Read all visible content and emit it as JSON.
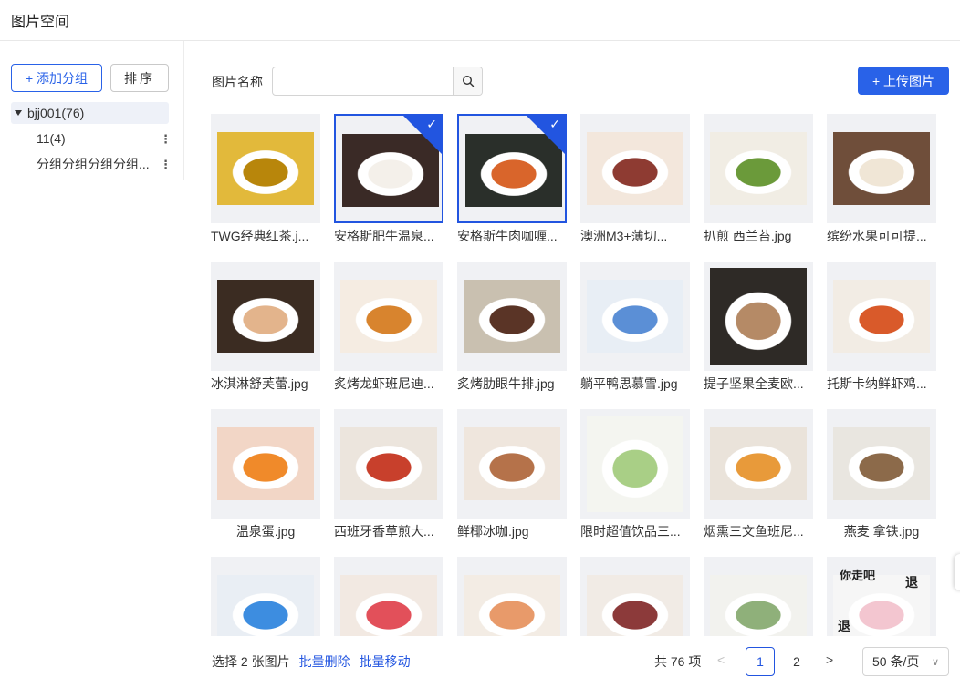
{
  "header": {
    "title": "图片空间"
  },
  "sidebar": {
    "add_group_label": "+ 添加分组",
    "sort_label": "排序",
    "root": {
      "label": "bjj001(76)"
    },
    "children": [
      {
        "label": "11(4)"
      },
      {
        "label": "分组分组分组分组..."
      }
    ]
  },
  "toolbar": {
    "search_label": "图片名称",
    "search_value": "",
    "search_placeholder": "",
    "upload_label": "+ 上传图片"
  },
  "images": [
    {
      "name": "TWG经典红茶.j...",
      "selected": false,
      "color1": "#e2b93b",
      "color2": "#b8860b"
    },
    {
      "name": "安格斯肥牛温泉...",
      "selected": true,
      "color1": "#3a2a26",
      "color2": "#f4f0ea"
    },
    {
      "name": "安格斯牛肉咖喱...",
      "selected": true,
      "color1": "#2a2f2a",
      "color2": "#d9652b"
    },
    {
      "name": "澳洲M3+薄切...",
      "selected": false,
      "color1": "#f3e7dc",
      "color2": "#8e3b32"
    },
    {
      "name": "扒煎 西兰苔.jpg",
      "selected": false,
      "color1": "#f1ede4",
      "color2": "#6b9a3a"
    },
    {
      "name": "缤纷水果可可提...",
      "selected": false,
      "color1": "#6f4e3a",
      "color2": "#f0e6d6"
    },
    {
      "name": "冰淇淋舒芙蕾.jpg",
      "selected": false,
      "color1": "#3b2c22",
      "color2": "#e3b48c"
    },
    {
      "name": "炙烤龙虾班尼迪...",
      "selected": false,
      "color1": "#f5ece2",
      "color2": "#d8842e"
    },
    {
      "name": "炙烤肋眼牛排.jpg",
      "selected": false,
      "color1": "#c9c0b0",
      "color2": "#5a3426"
    },
    {
      "name": "躺平鸭思慕雪.jpg",
      "selected": false,
      "color1": "#e8eef5",
      "color2": "#5b8fd6"
    },
    {
      "name": "提子坚果全麦欧...",
      "selected": false,
      "color1": "#2e2a26",
      "color2": "#b58a66"
    },
    {
      "name": "托斯卡纳鲜虾鸡...",
      "selected": false,
      "color1": "#f2ece4",
      "color2": "#d95a2a"
    },
    {
      "name": "温泉蛋.jpg",
      "selected": false,
      "color1": "#f2d6c6",
      "color2": "#f08a2a"
    },
    {
      "name": "西班牙香草煎大...",
      "selected": false,
      "color1": "#ece5dd",
      "color2": "#c8402c"
    },
    {
      "name": "鲜椰冰咖.jpg",
      "selected": false,
      "color1": "#efe6dd",
      "color2": "#b5724a"
    },
    {
      "name": "限时超值饮品三...",
      "selected": false,
      "color1": "#f4f5f0",
      "color2": "#a9cf86"
    },
    {
      "name": "烟熏三文鱼班尼...",
      "selected": false,
      "color1": "#eae3da",
      "color2": "#e89a3a"
    },
    {
      "name": "燕麦 拿铁.jpg",
      "selected": false,
      "color1": "#e9e6e0",
      "color2": "#8c6a4a"
    },
    {
      "name": "",
      "selected": false,
      "color1": "#e9eef4",
      "color2": "#3d8de0"
    },
    {
      "name": "",
      "selected": false,
      "color1": "#f2e9e2",
      "color2": "#e2505a"
    },
    {
      "name": "",
      "selected": false,
      "color1": "#f3ece4",
      "color2": "#e89a6a"
    },
    {
      "name": "",
      "selected": false,
      "color1": "#f1ebe5",
      "color2": "#8c3a3a"
    },
    {
      "name": "",
      "selected": false,
      "color1": "#f2f2ee",
      "color2": "#8fb07a"
    },
    {
      "name": "",
      "selected": false,
      "color1": "#f6f6f6",
      "color2": "#f3c6d0",
      "sticker_text_1": "你走吧",
      "sticker_text_2": "退",
      "sticker_text_3": "退"
    }
  ],
  "footer": {
    "selected_text": "选择 2 张图片",
    "batch_delete": "批量删除",
    "batch_move": "批量移动",
    "total_text": "共 76 项",
    "page_1": "1",
    "page_2": "2",
    "page_size": "50 条/页"
  }
}
